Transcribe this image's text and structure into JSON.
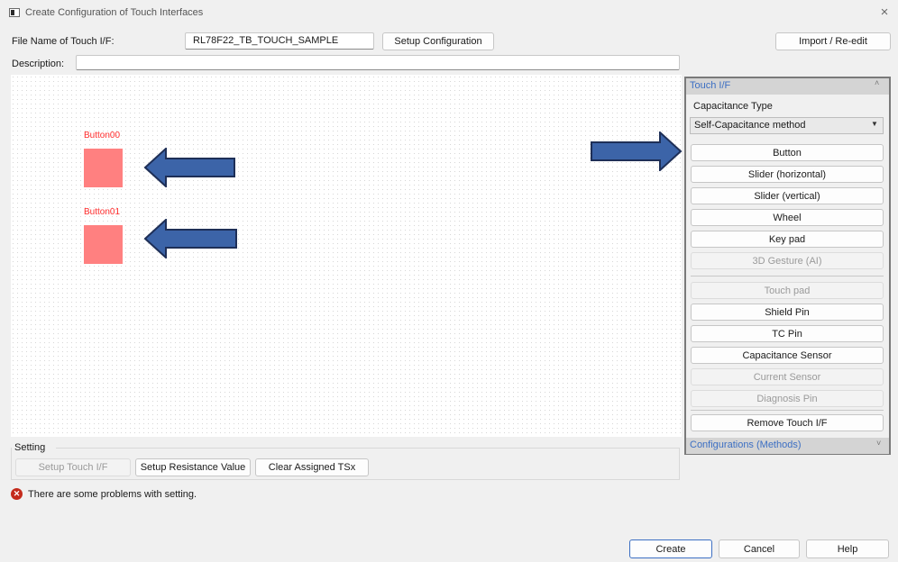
{
  "window": {
    "title": "Create Configuration of Touch Interfaces",
    "close_glyph": "×"
  },
  "file": {
    "label": "File Name of Touch I/F:",
    "value": "RL78F22_TB_TOUCH_SAMPLE",
    "setup_config_label": "Setup Configuration",
    "import_label": "Import / Re-edit"
  },
  "description": {
    "label": "Description:",
    "value": ""
  },
  "canvas": {
    "buttons": [
      {
        "label": "Button00"
      },
      {
        "label": "Button01"
      }
    ],
    "arrow_color": "#3c64a8"
  },
  "touch_panel": {
    "title": "Touch I/F",
    "capacitance_type_label": "Capacitance Type",
    "capacitance_type_value": "Self-Capacitance method",
    "items": [
      {
        "label": "Button",
        "enabled": true
      },
      {
        "label": "Slider (horizontal)",
        "enabled": true
      },
      {
        "label": "Slider (vertical)",
        "enabled": true
      },
      {
        "label": "Wheel",
        "enabled": true
      },
      {
        "label": "Key pad",
        "enabled": true
      },
      {
        "label": "3D Gesture (AI)",
        "enabled": false
      },
      {
        "label": "Touch pad",
        "enabled": false
      },
      {
        "label": "Shield Pin",
        "enabled": true
      },
      {
        "label": "TC Pin",
        "enabled": true
      },
      {
        "label": "Capacitance Sensor",
        "enabled": true
      },
      {
        "label": "Current Sensor",
        "enabled": false
      },
      {
        "label": "Diagnosis Pin",
        "enabled": false
      },
      {
        "label": "Remove Touch I/F",
        "enabled": true
      }
    ],
    "configurations_title": "Configurations (Methods)"
  },
  "setting": {
    "label": "Setting",
    "setup_touch_label": "Setup Touch I/F",
    "setup_resistance_label": "Setup Resistance Value",
    "clear_tsx_label": "Clear Assigned TSx"
  },
  "status": {
    "error_message": "There are some problems with setting."
  },
  "footer": {
    "create_label": "Create",
    "cancel_label": "Cancel",
    "help_label": "Help"
  },
  "colors": {
    "accent": "#3c6fc3",
    "touch_label": "#ff2b2b",
    "touch_square": "#ff8080",
    "error": "#c42b1c"
  }
}
